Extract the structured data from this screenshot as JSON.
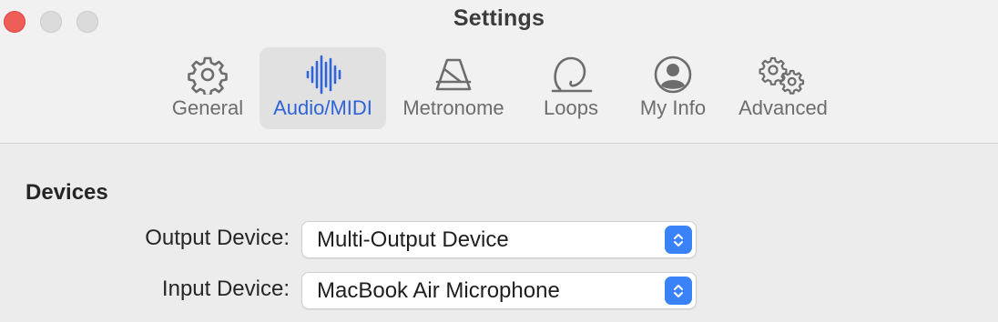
{
  "window": {
    "title": "Settings"
  },
  "toolbar": {
    "tabs": [
      {
        "label": "General",
        "icon": "gear-icon",
        "selected": false
      },
      {
        "label": "Audio/MIDI",
        "icon": "waveform-icon",
        "selected": true
      },
      {
        "label": "Metronome",
        "icon": "metronome-icon",
        "selected": false
      },
      {
        "label": "Loops",
        "icon": "loop-icon",
        "selected": false
      },
      {
        "label": "My Info",
        "icon": "person-circle-icon",
        "selected": false
      },
      {
        "label": "Advanced",
        "icon": "gears-icon",
        "selected": false
      }
    ]
  },
  "devices": {
    "title": "Devices",
    "output": {
      "label": "Output Device:",
      "value": "Multi-Output Device"
    },
    "input": {
      "label": "Input Device:",
      "value": "MacBook Air Microphone"
    }
  },
  "colors": {
    "accent": "#3a82f7",
    "selected_tab_text": "#2f63d8",
    "close_button": "#ee5e57"
  }
}
